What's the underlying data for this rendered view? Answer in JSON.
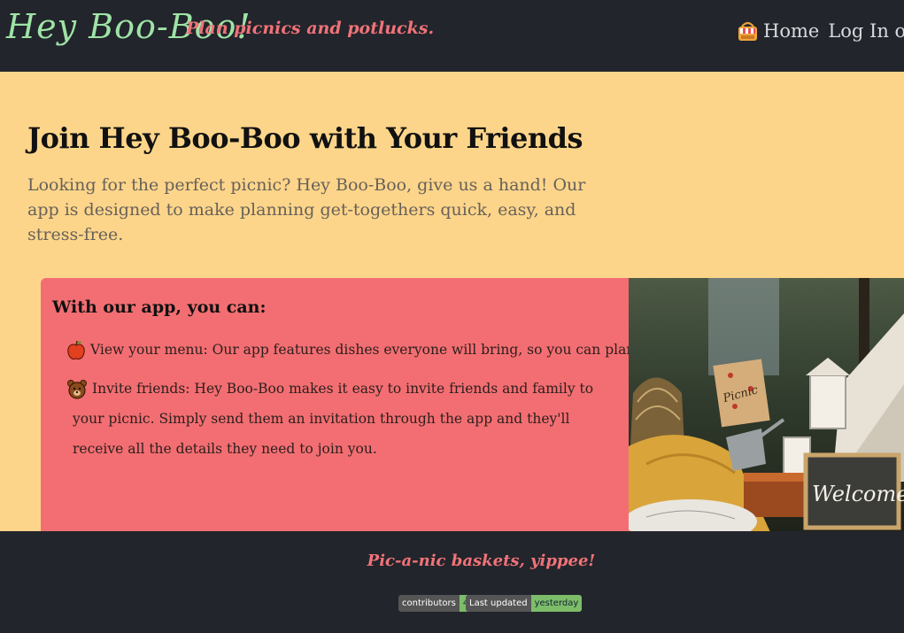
{
  "header": {
    "logo": "Hey Boo-Boo!",
    "tagline": "Plan picnics and potlucks.",
    "nav": {
      "icon": "picnic-basket-icon",
      "home": "Home",
      "login": "Log In or Si"
    }
  },
  "hero": {
    "title": "Join Hey Boo-Boo with Your Friends",
    "text": "Looking for the perfect picnic? Hey Boo-Boo, give us a hand! Our app is designed to make planning get-togethers quick, easy, and stress-free."
  },
  "card": {
    "heading": "With our app, you can:",
    "features": [
      {
        "icon": "apple-icon",
        "text": "View your menu: Our app features dishes everyone will bring, so you can plan ahead!"
      },
      {
        "icon": "bear-icon",
        "text": "Invite friends: Hey Boo-Boo makes it easy to invite friends and family to your picnic. Simply send them an invitation through the app and they'll receive all the details they need to join you."
      }
    ]
  },
  "photo": {
    "sign_text": "Welcome",
    "box_text": "Picnic"
  },
  "footer": {
    "text": "Pic-a-nic baskets, yippee!",
    "badges": [
      {
        "label": "contributors",
        "value": "4"
      },
      {
        "label": "Last updated",
        "value": "yesterday"
      }
    ]
  },
  "colors": {
    "header_bg": "#22252b",
    "page_bg": "#fdd58a",
    "card_bg": "#f36e72",
    "logo": "#9fe3a6",
    "accent": "#f07379"
  }
}
